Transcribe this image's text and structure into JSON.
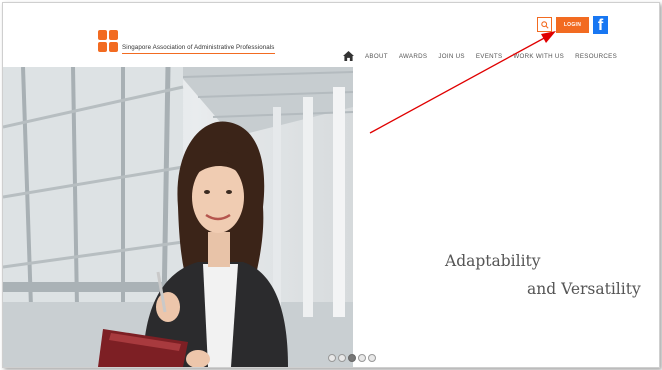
{
  "header": {
    "logo_text": "Singapore Association of Administrative Professionals",
    "login_label": "LOGIN",
    "facebook_glyph": "f"
  },
  "nav": {
    "items": [
      "ABOUT",
      "AWARDS",
      "JOIN US",
      "EVENTS",
      "WORK WITH US",
      "RESOURCES"
    ]
  },
  "hero": {
    "line1": "Adaptability",
    "line2": "and Versatility",
    "slide_count": 5,
    "active_slide": 2
  },
  "colors": {
    "brand_orange": "#f26b21",
    "facebook_blue": "#1877f2",
    "arrow_red": "#e00000"
  },
  "icons": [
    "search-icon",
    "home-icon",
    "facebook-icon"
  ]
}
